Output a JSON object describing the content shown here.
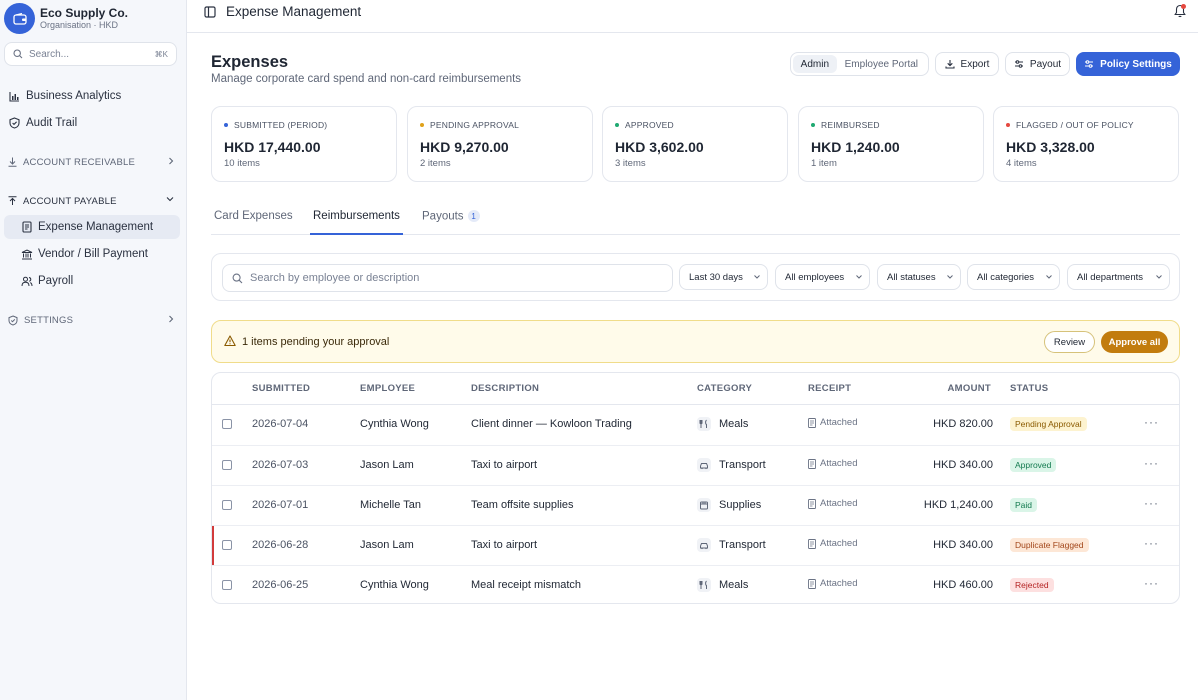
{
  "org": {
    "name": "Eco Supply Co.",
    "subtitle": "Organisation · HKD"
  },
  "search": {
    "placeholder": "Search...",
    "shortcut": "⌘K"
  },
  "nav": {
    "items": [
      {
        "label": "Business Analytics",
        "icon": "bar-chart-icon"
      },
      {
        "label": "Audit Trail",
        "icon": "shield-icon"
      }
    ],
    "sections": {
      "receivable": "ACCOUNT RECEIVABLE",
      "payable": "ACCOUNT PAYABLE",
      "settings": "SETTINGS"
    },
    "payable_items": [
      {
        "label": "Expense Management",
        "active": true
      },
      {
        "label": "Vendor / Bill Payment"
      },
      {
        "label": "Payroll"
      }
    ]
  },
  "topbar": {
    "title": "Expense Management"
  },
  "page": {
    "title": "Expenses",
    "subtitle": "Manage corporate card spend and non-card reimbursements",
    "toggle": {
      "admin": "Admin",
      "employee": "Employee Portal"
    },
    "buttons": {
      "export": "Export",
      "payout": "Payout",
      "policy": "Policy Settings"
    }
  },
  "stats": [
    {
      "label": "SUBMITTED (PERIOD)",
      "value": "HKD 17,440.00",
      "count": "10 items",
      "color": "#3563d8"
    },
    {
      "label": "PENDING APPROVAL",
      "value": "HKD 9,270.00",
      "count": "2 items",
      "color": "#e0a21a"
    },
    {
      "label": "APPROVED",
      "value": "HKD 3,602.00",
      "count": "3 items",
      "color": "#1fa971"
    },
    {
      "label": "REIMBURSED",
      "value": "HKD 1,240.00",
      "count": "1 item",
      "color": "#1fa971"
    },
    {
      "label": "FLAGGED / OUT OF POLICY",
      "value": "HKD 3,328.00",
      "count": "4 items",
      "color": "#e5483f"
    }
  ],
  "tabs": [
    {
      "label": "Card Expenses"
    },
    {
      "label": "Reimbursements",
      "active": true
    },
    {
      "label": "Payouts",
      "badge": "1"
    }
  ],
  "filters": {
    "search_placeholder": "Search by employee or description",
    "period": "Last 30 days",
    "employees": "All employees",
    "statuses": "All statuses",
    "categories": "All categories",
    "departments": "All departments"
  },
  "alert": {
    "text": "1 items pending your approval",
    "review": "Review",
    "approve_all": "Approve all"
  },
  "table": {
    "headers": {
      "submitted": "SUBMITTED",
      "employee": "EMPLOYEE",
      "description": "DESCRIPTION",
      "category": "CATEGORY",
      "receipt": "RECEIPT",
      "amount": "AMOUNT",
      "status": "STATUS"
    },
    "rows": [
      {
        "date": "2026-07-04",
        "employee": "Cynthia Wong",
        "description": "Client dinner — Kowloon Trading",
        "category": "Meals",
        "cat_icon": "utensils-icon",
        "receipt": "Attached",
        "amount": "HKD 820.00",
        "status": "Pending Approval",
        "status_bg": "#fdf3d0",
        "status_fg": "#8a5a00",
        "flag": false
      },
      {
        "date": "2026-07-03",
        "employee": "Jason Lam",
        "description": "Taxi to airport",
        "category": "Transport",
        "cat_icon": "car-icon",
        "receipt": "Attached",
        "amount": "HKD 340.00",
        "status": "Approved",
        "status_bg": "#daf5e8",
        "status_fg": "#137a4f",
        "flag": false
      },
      {
        "date": "2026-07-01",
        "employee": "Michelle Tan",
        "description": "Team offsite supplies",
        "category": "Supplies",
        "cat_icon": "box-icon",
        "receipt": "Attached",
        "amount": "HKD 1,240.00",
        "status": "Paid",
        "status_bg": "#daf5e8",
        "status_fg": "#137a4f",
        "flag": false
      },
      {
        "date": "2026-06-28",
        "employee": "Jason Lam",
        "description": "Taxi to airport",
        "category": "Transport",
        "cat_icon": "car-icon",
        "receipt": "Attached",
        "amount": "HKD 340.00",
        "status": "Duplicate Flagged",
        "status_bg": "#fde7d6",
        "status_fg": "#a2461a",
        "flag": true
      },
      {
        "date": "2026-06-25",
        "employee": "Cynthia Wong",
        "description": "Meal receipt mismatch",
        "category": "Meals",
        "cat_icon": "utensils-icon",
        "receipt": "Attached",
        "amount": "HKD 460.00",
        "status": "Rejected",
        "status_bg": "#fde0e0",
        "status_fg": "#b42323",
        "flag": false
      }
    ]
  }
}
